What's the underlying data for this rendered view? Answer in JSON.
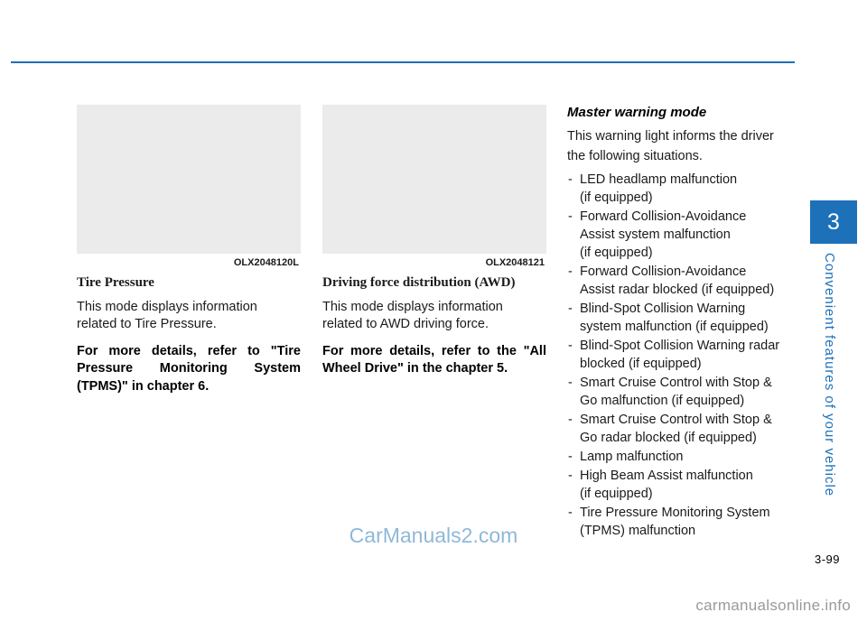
{
  "page": {
    "number": "3-99",
    "chapter_number": "3",
    "chapter_title": "Convenient features of your vehicle"
  },
  "columns": {
    "col1": {
      "figure_code": "OLX2048120L",
      "heading": "Tire Pressure",
      "paragraph": "This mode displays information related to Tire Pressure.",
      "bold_note": "For more details, refer to \"Tire Pressure Monitoring System (TPMS)\" in chapter 6."
    },
    "col2": {
      "figure_code": "OLX2048121",
      "heading": "Driving force distribution (AWD)",
      "paragraph": "This mode displays information related to AWD driving force.",
      "bold_note": "For more details, refer to the \"All Wheel Drive\" in the chapter 5."
    },
    "col3": {
      "title": "Master warning mode",
      "intro_line1": "This warning light informs the driver",
      "intro_line2": "the following situations.",
      "items": [
        {
          "line1": "LED headlamp malfunction",
          "line2": "(if equipped)"
        },
        {
          "line1": "Forward Collision-Avoidance",
          "line2": "Assist system malfunction",
          "line3": "(if equipped)"
        },
        {
          "line1": "Forward Collision-Avoidance",
          "line2": "Assist radar blocked (if equipped)"
        },
        {
          "line1": "Blind-Spot Collision Warning",
          "line2": "system malfunction (if equipped)"
        },
        {
          "line1": "Blind-Spot Collision Warning radar",
          "line2": "blocked (if equipped)"
        },
        {
          "line1": "Smart Cruise Control with Stop &",
          "line2": "Go malfunction (if equipped)"
        },
        {
          "line1": "Smart Cruise Control with Stop &",
          "line2": "Go radar blocked (if equipped)"
        },
        {
          "line1": "Lamp malfunction"
        },
        {
          "line1": "High Beam Assist malfunction",
          "line2": "(if equipped)"
        },
        {
          "line1": "Tire Pressure Monitoring System",
          "line2": "(TPMS) malfunction"
        }
      ]
    }
  },
  "watermarks": {
    "main": "CarManuals2.com",
    "bottom": "carmanualsonline.info"
  },
  "colors": {
    "accent": "#1d71b8",
    "figure_bg": "#ebebeb",
    "watermark_main": "#8fb8d8",
    "watermark_bottom": "#9a9a9a"
  }
}
